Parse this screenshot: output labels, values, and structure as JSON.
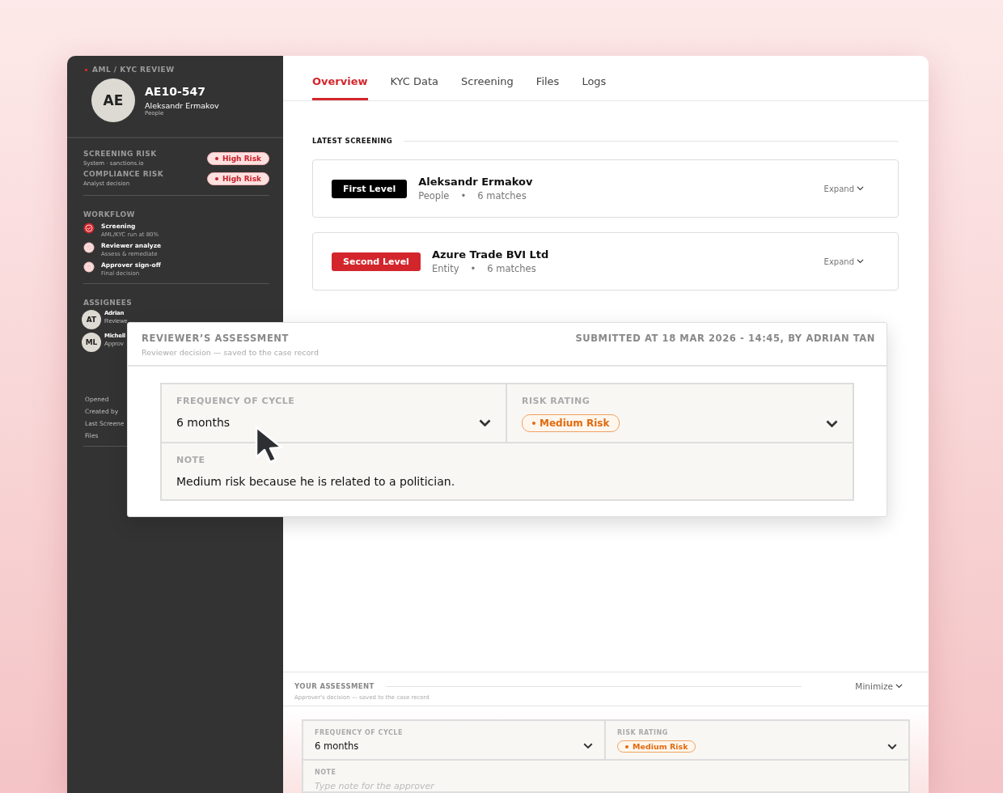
{
  "sidebar": {
    "eyebrow": "AML / KYC REVIEW",
    "avatar": "AE",
    "case_id": "AE10-547",
    "name": "Aleksandr Ermakov",
    "type": "People",
    "risks": [
      {
        "label": "SCREENING RISK",
        "source": "System · sanctions.io",
        "badge": "High Risk",
        "kind": "high"
      },
      {
        "label": "COMPLIANCE RISK",
        "source": "Analyst decision",
        "badge": "High Risk",
        "kind": "high"
      }
    ],
    "workflow": {
      "title": "WORKFLOW",
      "steps": [
        {
          "title": "Screening",
          "detail": "AML/KYC run at 80%",
          "done": true
        },
        {
          "title": "Reviewer analyze",
          "detail": "Assess & remediate",
          "done": false
        },
        {
          "title": "Approver sign-off",
          "detail": "Final decision",
          "done": false
        }
      ]
    },
    "assignees": {
      "title": "ASSIGNEES",
      "items": [
        {
          "initials": "AT",
          "name": "Adrian",
          "role": "Reviewe"
        },
        {
          "initials": "ML",
          "name": "Michell",
          "role": "Approv"
        }
      ]
    },
    "meta": [
      "Opened",
      "Created by",
      "Last Screene",
      "Files"
    ]
  },
  "tabs": [
    {
      "label": "Overview",
      "selected": true
    },
    {
      "label": "KYC Data",
      "selected": false
    },
    {
      "label": "Screening",
      "selected": false
    },
    {
      "label": "Files",
      "selected": false
    },
    {
      "label": "Logs",
      "selected": false
    }
  ],
  "latest_screening": {
    "title": "LATEST SCREENING",
    "cards": [
      {
        "level": "First Level",
        "kind": "first",
        "name": "Aleksandr Ermakov",
        "type": "People",
        "separator": "•",
        "matches": "6 matches",
        "action": "Expand"
      },
      {
        "level": "Second Level",
        "kind": "second",
        "name": "Azure Trade BVI Ltd",
        "type": "Entity",
        "separator": "•",
        "matches": "6 matches",
        "action": "Expand"
      }
    ]
  },
  "reviewer_assessment": {
    "title": "REVIEWER’S ASSESSMENT",
    "subtitle": "Reviewer decision — saved to the case record",
    "submitted": "SUBMITTED AT 18 MAR 2026 - 14:45, BY ADRIAN TAN",
    "frequency_label": "FREQUENCY OF CYCLE",
    "frequency": "6 months",
    "risk_label": "RISK RATING",
    "risk": "Medium Risk",
    "note_label": "NOTE",
    "note": "Medium risk because he is related to a politician."
  },
  "your_assessment": {
    "title": "YOUR ASSESSMENT",
    "subtitle": "Approver's decision — saved to the case record",
    "action": "Minimize",
    "frequency_label": "FREQUENCY OF CYCLE",
    "frequency": "6 months",
    "risk_label": "RISK RATING",
    "risk": "Medium Risk",
    "note_label": "NOTE",
    "placeholder": "Type note for the approver"
  }
}
